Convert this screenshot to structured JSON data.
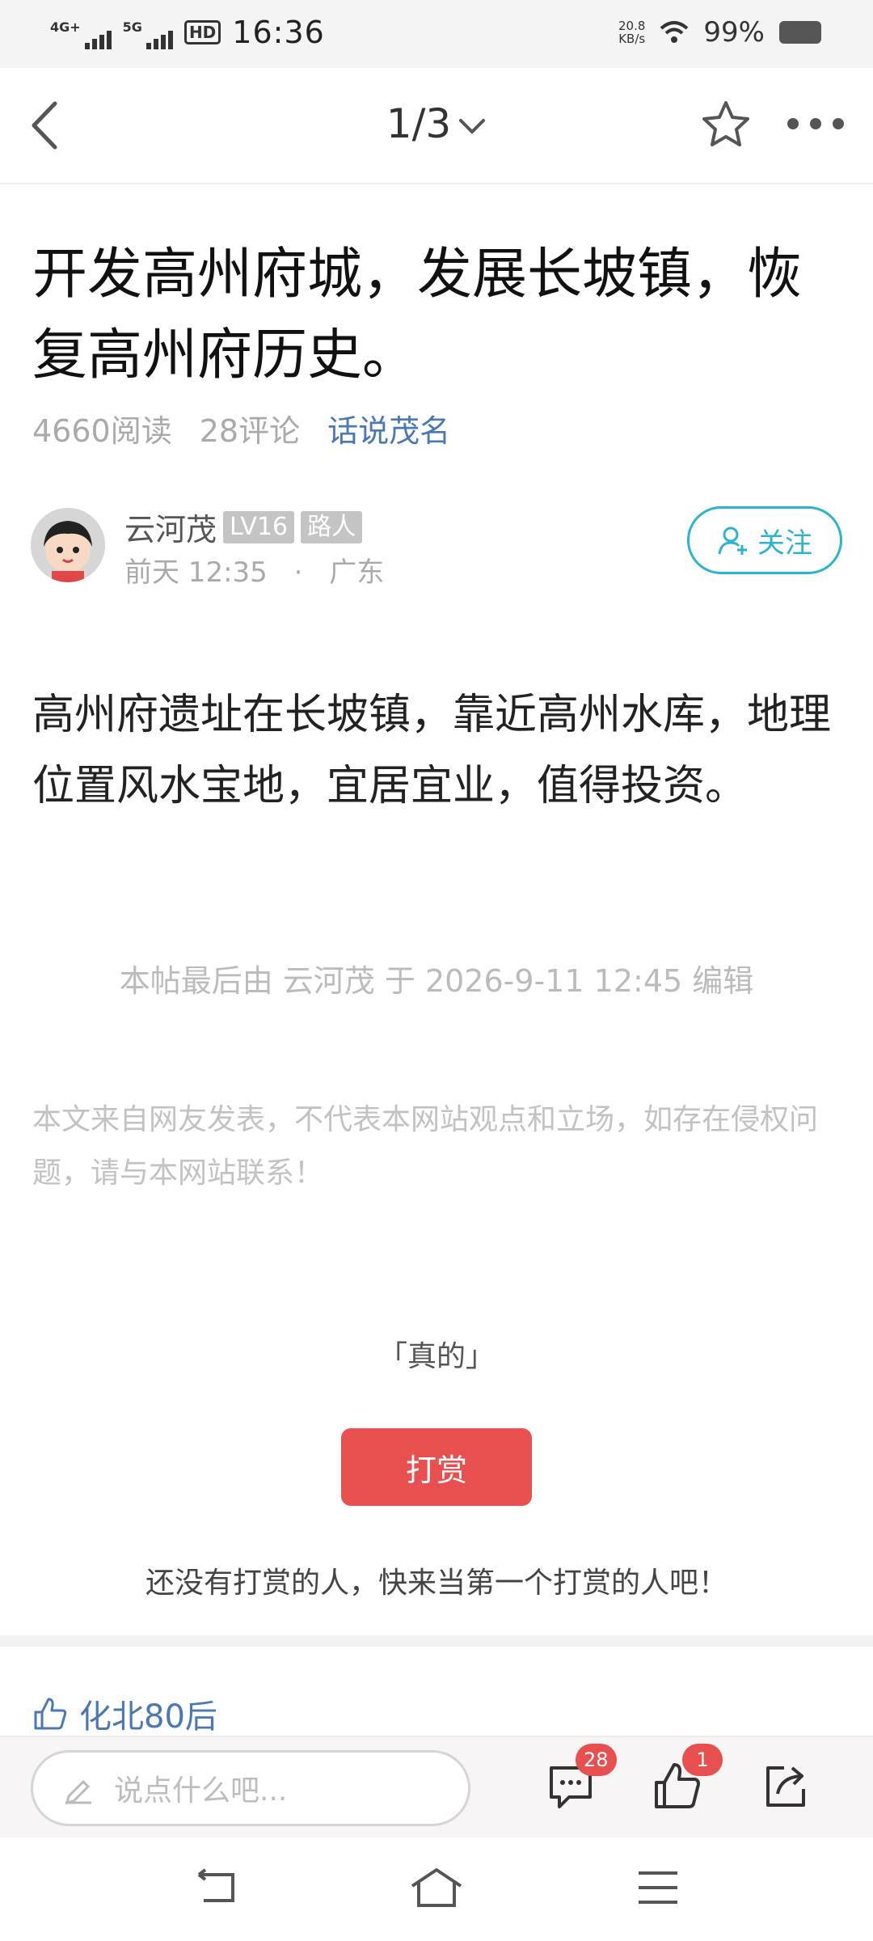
{
  "status_bar": {
    "net1": "4G+",
    "net2": "5G",
    "hd": "HD",
    "time": "16:36",
    "speed_value": "20.8",
    "speed_unit": "KB/s",
    "battery": "99%"
  },
  "header": {
    "page_indicator": "1/3"
  },
  "post": {
    "title": "开发高州府城，发展长坡镇，恢复高州府历史。",
    "reads": "4660阅读",
    "comments": "28评论",
    "forum": "话说茂名",
    "author_name": "云河茂",
    "level": "LV16",
    "rank": "路人",
    "time": "前天 12:35",
    "separator": "·",
    "location": "广东",
    "follow_label": "关注",
    "body": "高州府遗址在长坡镇，靠近高州水库，地理位置风水宝地，宜居宜业，值得投资。",
    "edit_note": "本帖最后由 云河茂 于 2026-9-11 12:45 编辑",
    "disclaimer": "本文来自网友发表，不代表本网站观点和立场，如存在侵权问题，请与本网站联系！",
    "quote": "「真的」",
    "reward_label": "打赏",
    "reward_note": "还没有打赏的人，快来当第一个打赏的人吧！",
    "liked_by": "化北80后"
  },
  "action_bar": {
    "comment_placeholder": "说点什么吧...",
    "comment_count": "28",
    "like_count": "1"
  },
  "colors": {
    "accent_blue": "#4a77b5",
    "follow_cyan": "#2bb3d1",
    "reward_red": "#e85050"
  }
}
